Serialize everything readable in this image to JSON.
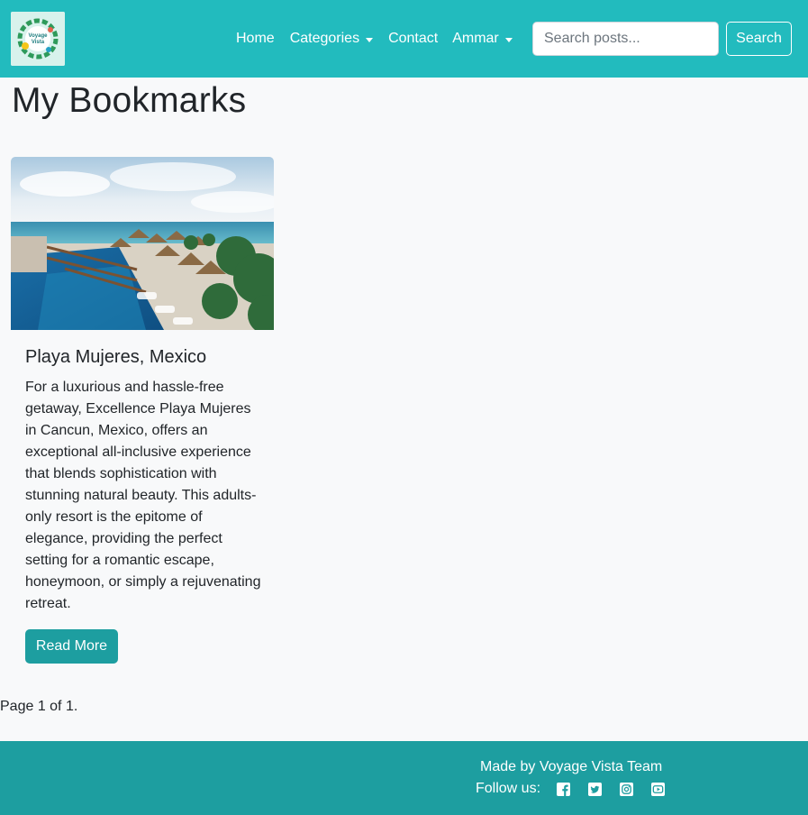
{
  "navbar": {
    "logo_text": "Voyage Vista",
    "links": [
      {
        "label": "Home"
      },
      {
        "label": "Categories"
      },
      {
        "label": "Contact"
      },
      {
        "label": "Ammar"
      }
    ],
    "search": {
      "placeholder": "Search posts...",
      "value": "",
      "button_label": "Search"
    }
  },
  "page": {
    "title": "My Bookmarks"
  },
  "card": {
    "title": "Playa Mujeres, Mexico",
    "text": "For a luxurious and hassle-free getaway, Excellence Playa Mujeres in Cancun, Mexico, offers an exceptional all-inclusive experience that blends sophistication with stunning natural beauty. This adults-only resort is the epitome of elegance, providing the perfect setting for a romantic escape, honeymoon, or simply a rejuvenating retreat.",
    "button_label": "Read More"
  },
  "pagination": {
    "text": "Page 1 of 1."
  },
  "footer": {
    "made_by": "Made by Voyage Vista Team",
    "follow_label": "Follow us:",
    "social_icons": [
      "facebook-icon",
      "twitter-icon",
      "instagram-icon",
      "youtube-icon"
    ]
  },
  "colors": {
    "navbar": "#22bbbe",
    "footer": "#1d9ea0",
    "button": "#1d9ea0",
    "background": "#f8f9fa"
  }
}
